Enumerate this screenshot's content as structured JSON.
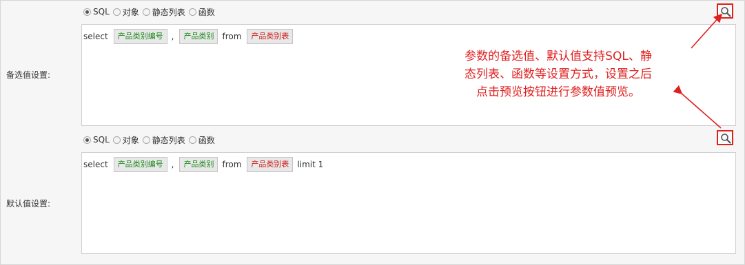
{
  "sections": [
    {
      "label": "备选值设置:",
      "radio_options": [
        {
          "text": "SQL",
          "checked": true
        },
        {
          "text": "对象",
          "checked": false
        },
        {
          "text": "静态列表",
          "checked": false
        },
        {
          "text": "函数",
          "checked": false
        }
      ],
      "sql": {
        "kw_select": "select",
        "token1": "产品类别编号",
        "comma": ",",
        "token2": "产品类别",
        "kw_from": "from",
        "token3": "产品类别表",
        "tail": ""
      }
    },
    {
      "label": "默认值设置:",
      "radio_options": [
        {
          "text": "SQL",
          "checked": true
        },
        {
          "text": "对象",
          "checked": false
        },
        {
          "text": "静态列表",
          "checked": false
        },
        {
          "text": "函数",
          "checked": false
        }
      ],
      "sql": {
        "kw_select": "select",
        "token1": "产品类别编号",
        "comma": ",",
        "token2": "产品类别",
        "kw_from": "from",
        "token3": "产品类别表",
        "tail": "limit 1"
      }
    }
  ],
  "annotation": {
    "line1": "参数的备选值、默认值支持SQL、静",
    "line2": "态列表、函数等设置方式，设置之后",
    "line3": "点击预览按钮进行参数值预览。"
  },
  "icons": {
    "preview": "search-icon"
  },
  "colors": {
    "annotation": "#e02020",
    "field_token": "#1d8a1d",
    "table_token": "#d11c1c"
  }
}
